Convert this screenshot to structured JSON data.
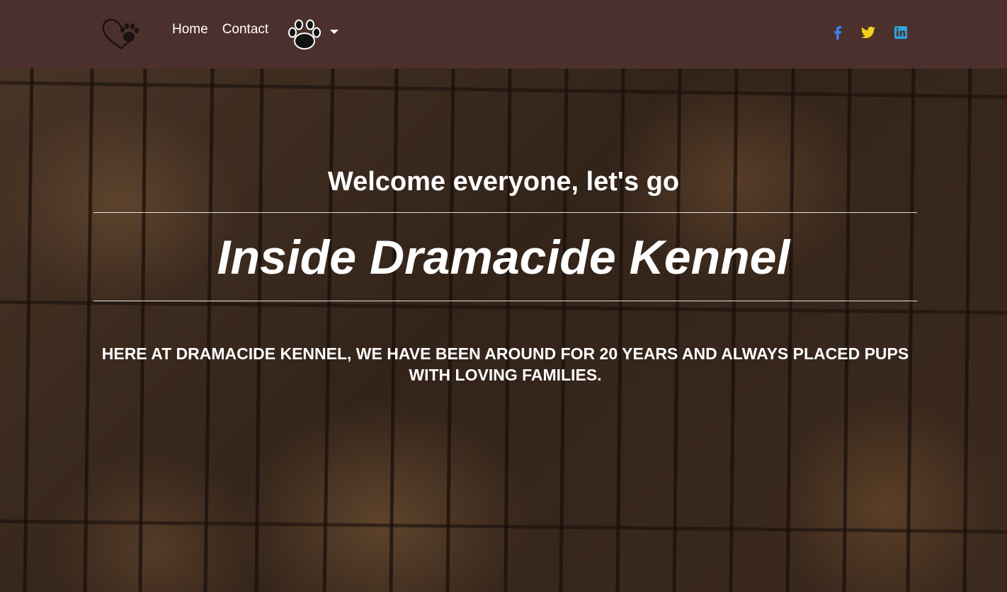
{
  "nav": {
    "logo": "heart-paw-logo",
    "links": [
      "Home",
      "Contact"
    ],
    "dropdown_icon": "paw-icon"
  },
  "social": [
    {
      "name": "facebook-icon",
      "color": "#3b82f6"
    },
    {
      "name": "twitter-icon",
      "color": "#f2d21c"
    },
    {
      "name": "linkedin-icon",
      "color": "#2ea3dc"
    }
  ],
  "hero": {
    "welcome": "Welcome everyone, let's go",
    "title": "Inside Dramacide Kennel",
    "tagline": "HERE AT DRAMACIDE KENNEL, WE HAVE BEEN AROUND FOR 20 YEARS AND ALWAYS PLACED PUPS WITH LOVING FAMILIES."
  },
  "colors": {
    "navbar": "#4c302d",
    "text": "#ffffff"
  }
}
